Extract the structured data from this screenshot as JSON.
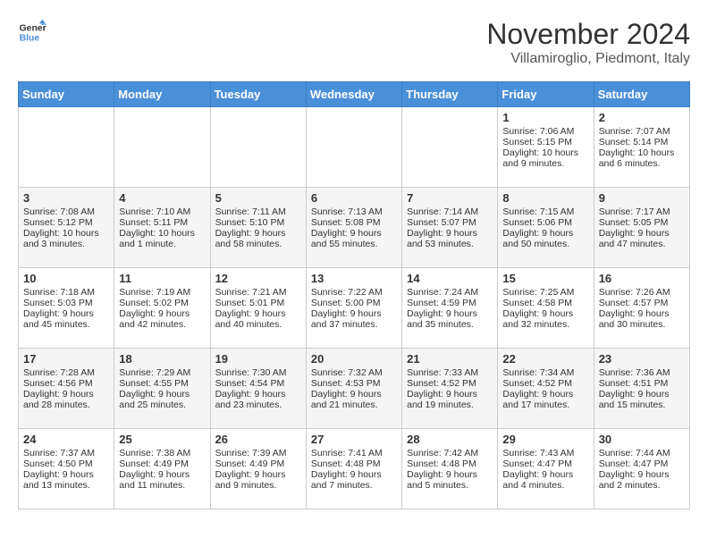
{
  "header": {
    "logo_general": "General",
    "logo_blue": "Blue",
    "month_title": "November 2024",
    "location": "Villamiroglio, Piedmont, Italy"
  },
  "days_of_week": [
    "Sunday",
    "Monday",
    "Tuesday",
    "Wednesday",
    "Thursday",
    "Friday",
    "Saturday"
  ],
  "weeks": [
    [
      {
        "day": "",
        "info": ""
      },
      {
        "day": "",
        "info": ""
      },
      {
        "day": "",
        "info": ""
      },
      {
        "day": "",
        "info": ""
      },
      {
        "day": "",
        "info": ""
      },
      {
        "day": "1",
        "info": "Sunrise: 7:06 AM\nSunset: 5:15 PM\nDaylight: 10 hours and 9 minutes."
      },
      {
        "day": "2",
        "info": "Sunrise: 7:07 AM\nSunset: 5:14 PM\nDaylight: 10 hours and 6 minutes."
      }
    ],
    [
      {
        "day": "3",
        "info": "Sunrise: 7:08 AM\nSunset: 5:12 PM\nDaylight: 10 hours and 3 minutes."
      },
      {
        "day": "4",
        "info": "Sunrise: 7:10 AM\nSunset: 5:11 PM\nDaylight: 10 hours and 1 minute."
      },
      {
        "day": "5",
        "info": "Sunrise: 7:11 AM\nSunset: 5:10 PM\nDaylight: 9 hours and 58 minutes."
      },
      {
        "day": "6",
        "info": "Sunrise: 7:13 AM\nSunset: 5:08 PM\nDaylight: 9 hours and 55 minutes."
      },
      {
        "day": "7",
        "info": "Sunrise: 7:14 AM\nSunset: 5:07 PM\nDaylight: 9 hours and 53 minutes."
      },
      {
        "day": "8",
        "info": "Sunrise: 7:15 AM\nSunset: 5:06 PM\nDaylight: 9 hours and 50 minutes."
      },
      {
        "day": "9",
        "info": "Sunrise: 7:17 AM\nSunset: 5:05 PM\nDaylight: 9 hours and 47 minutes."
      }
    ],
    [
      {
        "day": "10",
        "info": "Sunrise: 7:18 AM\nSunset: 5:03 PM\nDaylight: 9 hours and 45 minutes."
      },
      {
        "day": "11",
        "info": "Sunrise: 7:19 AM\nSunset: 5:02 PM\nDaylight: 9 hours and 42 minutes."
      },
      {
        "day": "12",
        "info": "Sunrise: 7:21 AM\nSunset: 5:01 PM\nDaylight: 9 hours and 40 minutes."
      },
      {
        "day": "13",
        "info": "Sunrise: 7:22 AM\nSunset: 5:00 PM\nDaylight: 9 hours and 37 minutes."
      },
      {
        "day": "14",
        "info": "Sunrise: 7:24 AM\nSunset: 4:59 PM\nDaylight: 9 hours and 35 minutes."
      },
      {
        "day": "15",
        "info": "Sunrise: 7:25 AM\nSunset: 4:58 PM\nDaylight: 9 hours and 32 minutes."
      },
      {
        "day": "16",
        "info": "Sunrise: 7:26 AM\nSunset: 4:57 PM\nDaylight: 9 hours and 30 minutes."
      }
    ],
    [
      {
        "day": "17",
        "info": "Sunrise: 7:28 AM\nSunset: 4:56 PM\nDaylight: 9 hours and 28 minutes."
      },
      {
        "day": "18",
        "info": "Sunrise: 7:29 AM\nSunset: 4:55 PM\nDaylight: 9 hours and 25 minutes."
      },
      {
        "day": "19",
        "info": "Sunrise: 7:30 AM\nSunset: 4:54 PM\nDaylight: 9 hours and 23 minutes."
      },
      {
        "day": "20",
        "info": "Sunrise: 7:32 AM\nSunset: 4:53 PM\nDaylight: 9 hours and 21 minutes."
      },
      {
        "day": "21",
        "info": "Sunrise: 7:33 AM\nSunset: 4:52 PM\nDaylight: 9 hours and 19 minutes."
      },
      {
        "day": "22",
        "info": "Sunrise: 7:34 AM\nSunset: 4:52 PM\nDaylight: 9 hours and 17 minutes."
      },
      {
        "day": "23",
        "info": "Sunrise: 7:36 AM\nSunset: 4:51 PM\nDaylight: 9 hours and 15 minutes."
      }
    ],
    [
      {
        "day": "24",
        "info": "Sunrise: 7:37 AM\nSunset: 4:50 PM\nDaylight: 9 hours and 13 minutes."
      },
      {
        "day": "25",
        "info": "Sunrise: 7:38 AM\nSunset: 4:49 PM\nDaylight: 9 hours and 11 minutes."
      },
      {
        "day": "26",
        "info": "Sunrise: 7:39 AM\nSunset: 4:49 PM\nDaylight: 9 hours and 9 minutes."
      },
      {
        "day": "27",
        "info": "Sunrise: 7:41 AM\nSunset: 4:48 PM\nDaylight: 9 hours and 7 minutes."
      },
      {
        "day": "28",
        "info": "Sunrise: 7:42 AM\nSunset: 4:48 PM\nDaylight: 9 hours and 5 minutes."
      },
      {
        "day": "29",
        "info": "Sunrise: 7:43 AM\nSunset: 4:47 PM\nDaylight: 9 hours and 4 minutes."
      },
      {
        "day": "30",
        "info": "Sunrise: 7:44 AM\nSunset: 4:47 PM\nDaylight: 9 hours and 2 minutes."
      }
    ]
  ]
}
